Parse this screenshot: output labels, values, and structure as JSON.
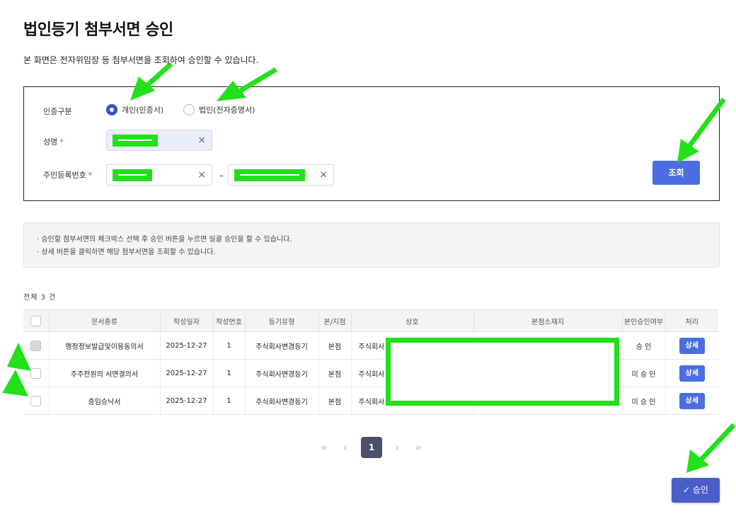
{
  "page": {
    "title": "법인등기 첨부서면 승인",
    "description": "본 화면은 전자위임장 등 첨부서면을 조회하여 승인할 수 있습니다."
  },
  "search": {
    "auth_label": "인증구분",
    "auth_options": [
      "개인(인증서)",
      "법인(전자증명서)"
    ],
    "auth_selected": "개인(인증서)",
    "name_label": "성명",
    "rrn_label": "주민등록번호",
    "required_mark": "*",
    "clear_icon": "×",
    "dash": "–",
    "search_button": "조회"
  },
  "info": {
    "lines": [
      "· 승인할 첨부서면의 체크박스 선택 후 승인 버튼을 누르면 일괄 승인을 할 수 있습니다.",
      "· 상세 버튼을 클릭하면 해당 첨부서면을 조회할 수 있습니다."
    ]
  },
  "table": {
    "total": "전체 3 건",
    "headers": [
      "문서종류",
      "작성일자",
      "작성번호",
      "등기유형",
      "본/지점",
      "상호",
      "본점소재지",
      "본인승인여부",
      "처리"
    ],
    "rows": [
      {
        "doc": "행정정보발급및이용동의서",
        "date": "2025-12-27",
        "no": "1",
        "type": "주식회사변경등기",
        "branch": "본점",
        "company": "주식회사",
        "address": "",
        "approved": "승 인",
        "action": "상세"
      },
      {
        "doc": "주주전원의 서면결의서",
        "date": "2025-12-27",
        "no": "1",
        "type": "주식회사변경등기",
        "branch": "본점",
        "company": "주식회사",
        "address": "",
        "approved": "미 승 인",
        "action": "상세"
      },
      {
        "doc": "중임승낙서",
        "date": "2025-12-27",
        "no": "1",
        "type": "주식회사변경등기",
        "branch": "본점",
        "company": "주식회사",
        "address": "",
        "approved": "미 승 인",
        "action": "상세"
      }
    ]
  },
  "pagination": {
    "first": "«",
    "prev": "‹",
    "current": "1",
    "next": "›",
    "last": "»"
  },
  "approve_button": {
    "icon": "✓",
    "label": "승인"
  },
  "colors": {
    "primary": "#4a6ee0",
    "approve": "#4a5ec9",
    "annotation": "#22e01a",
    "required": "#e03c3c"
  }
}
